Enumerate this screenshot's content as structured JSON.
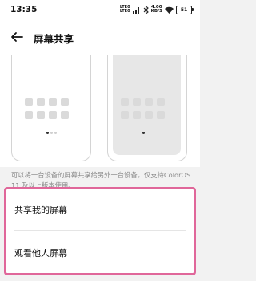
{
  "status_bar": {
    "time": "13:35",
    "network_line1": "LTE0",
    "network_line2": "LTE0",
    "speed_value": "4.00",
    "speed_unit": "KB/S",
    "battery": "51"
  },
  "header": {
    "title": "屏幕共享"
  },
  "illustration": {
    "left_phone": {
      "icon": "phone-outline"
    },
    "right_phone": {
      "icon": "phone-outline-grey"
    }
  },
  "description": "可以将一台设备的屏幕共享给另外一台设备。仅支持ColorOS 11 及以上版本使用。",
  "options": [
    {
      "label": "共享我的屏幕"
    },
    {
      "label": "观看他人屏幕"
    }
  ],
  "colors": {
    "highlight": "#e0679a",
    "background": "#f2f2f2"
  }
}
